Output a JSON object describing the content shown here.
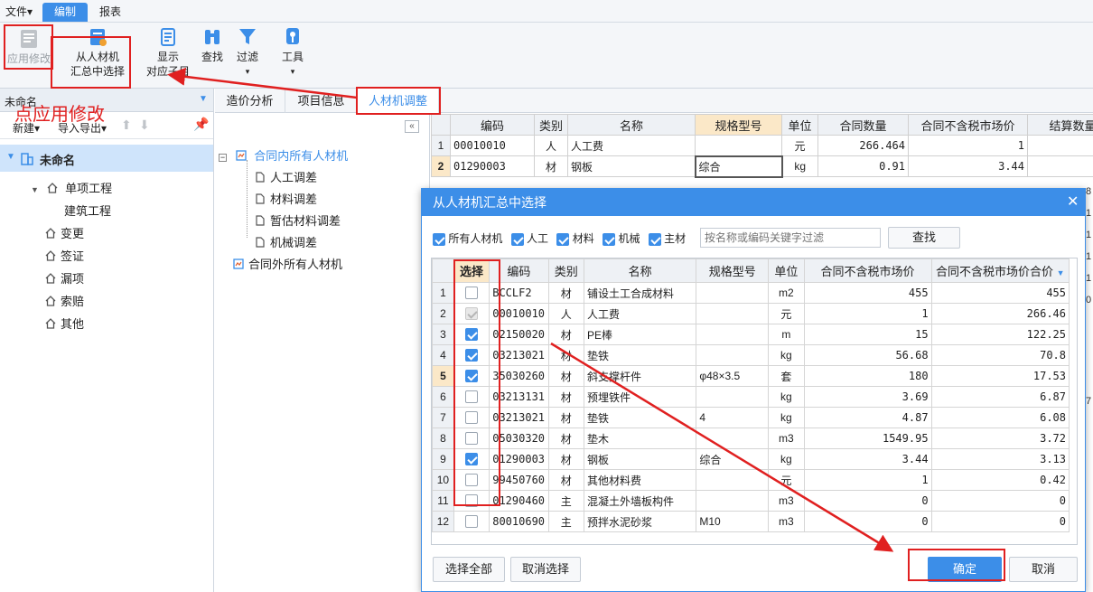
{
  "menubar": {
    "file": "文件",
    "edit": "编制",
    "report": "报表"
  },
  "toolbar": {
    "apply": "应用修改",
    "select_line1": "从人材机",
    "select_line2": "汇总中选择",
    "display_line1": "显示",
    "display_line2": "对应子目",
    "find": "查找",
    "filter": "过滤",
    "tools": "工具"
  },
  "left_panel": {
    "title": "未命名",
    "new": "新建",
    "import_export": "导入导出",
    "root": "未命名",
    "items": [
      "单项工程",
      "建筑工程",
      "变更",
      "签证",
      "漏项",
      "索赔",
      "其他"
    ]
  },
  "annotation": "点应用修改",
  "tabs": [
    "造价分析",
    "项目信息",
    "人材机调整"
  ],
  "mid_tree": {
    "group1": "合同内所有人材机",
    "children": [
      "人工调差",
      "材料调差",
      "暂估材料调差",
      "机械调差"
    ],
    "group2": "合同外所有人材机"
  },
  "bg_table": {
    "headers": [
      "编码",
      "类别",
      "名称",
      "规格型号",
      "单位",
      "合同数量",
      "合同不含税市场价",
      "结算数量"
    ],
    "rows": [
      {
        "n": "1",
        "code": "00010010",
        "type": "人",
        "name": "人工费",
        "spec": "",
        "unit": "元",
        "qty": "266.464",
        "price": "1",
        "settle": "26"
      },
      {
        "n": "2",
        "code": "01290003",
        "type": "材",
        "name": "钢板",
        "spec": "综合",
        "unit": "kg",
        "qty": "0.91",
        "price": "3.44",
        "settle": ""
      }
    ],
    "side_fragments": [
      "8",
      "1",
      "1",
      "1",
      "1",
      "0",
      "7"
    ]
  },
  "dialog": {
    "title": "从人材机汇总中选择",
    "filters": [
      {
        "label": "所有人材机",
        "checked": true
      },
      {
        "label": "人工",
        "checked": true
      },
      {
        "label": "材料",
        "checked": true
      },
      {
        "label": "机械",
        "checked": true
      },
      {
        "label": "主材",
        "checked": true
      }
    ],
    "search_placeholder": "按名称或编码关键字过滤",
    "search_button": "查找",
    "headers": [
      "选择",
      "编码",
      "类别",
      "名称",
      "规格型号",
      "单位",
      "合同不含税市场价",
      "合同不含税市场价合价"
    ],
    "rows": [
      {
        "n": "1",
        "state": "off",
        "code": "BCCLF2",
        "type": "材",
        "name": "铺设土工合成材料",
        "spec": "",
        "unit": "m2",
        "price": "455",
        "total": "455"
      },
      {
        "n": "2",
        "state": "dis",
        "code": "00010010",
        "type": "人",
        "name": "人工费",
        "spec": "",
        "unit": "元",
        "price": "1",
        "total": "266.46"
      },
      {
        "n": "3",
        "state": "on",
        "code": "02150020",
        "type": "材",
        "name": "PE棒",
        "spec": "",
        "unit": "m",
        "price": "15",
        "total": "122.25"
      },
      {
        "n": "4",
        "state": "on",
        "code": "03213021",
        "type": "材",
        "name": "垫铁",
        "spec": "",
        "unit": "kg",
        "price": "56.68",
        "total": "70.8"
      },
      {
        "n": "5",
        "state": "on",
        "code": "35030260",
        "type": "材",
        "name": "斜支撑杆件",
        "spec": "φ48×3.5",
        "unit": "套",
        "price": "180",
        "total": "17.53"
      },
      {
        "n": "6",
        "state": "off",
        "code": "03213131",
        "type": "材",
        "name": "预埋铁件",
        "spec": "",
        "unit": "kg",
        "price": "3.69",
        "total": "6.87"
      },
      {
        "n": "7",
        "state": "off",
        "code": "03213021",
        "type": "材",
        "name": "垫铁",
        "spec": "4",
        "unit": "kg",
        "price": "4.87",
        "total": "6.08"
      },
      {
        "n": "8",
        "state": "off",
        "code": "05030320",
        "type": "材",
        "name": "垫木",
        "spec": "",
        "unit": "m3",
        "price": "1549.95",
        "total": "3.72"
      },
      {
        "n": "9",
        "state": "on",
        "code": "01290003",
        "type": "材",
        "name": "钢板",
        "spec": "综合",
        "unit": "kg",
        "price": "3.44",
        "total": "3.13"
      },
      {
        "n": "10",
        "state": "off",
        "code": "99450760",
        "type": "材",
        "name": "其他材料费",
        "spec": "",
        "unit": "元",
        "price": "1",
        "total": "0.42"
      },
      {
        "n": "11",
        "state": "off",
        "code": "01290460",
        "type": "主",
        "name": "混凝土外墙板构件",
        "spec": "",
        "unit": "m3",
        "price": "0",
        "total": "0"
      },
      {
        "n": "12",
        "state": "off",
        "code": "80010690",
        "type": "主",
        "name": "预拌水泥砂浆",
        "spec": "M10",
        "unit": "m3",
        "price": "0",
        "total": "0"
      }
    ],
    "select_all": "选择全部",
    "deselect": "取消选择",
    "ok": "确定",
    "cancel": "取消"
  },
  "colors": {
    "accent": "#3c8ee8",
    "annotation": "#e02020"
  }
}
